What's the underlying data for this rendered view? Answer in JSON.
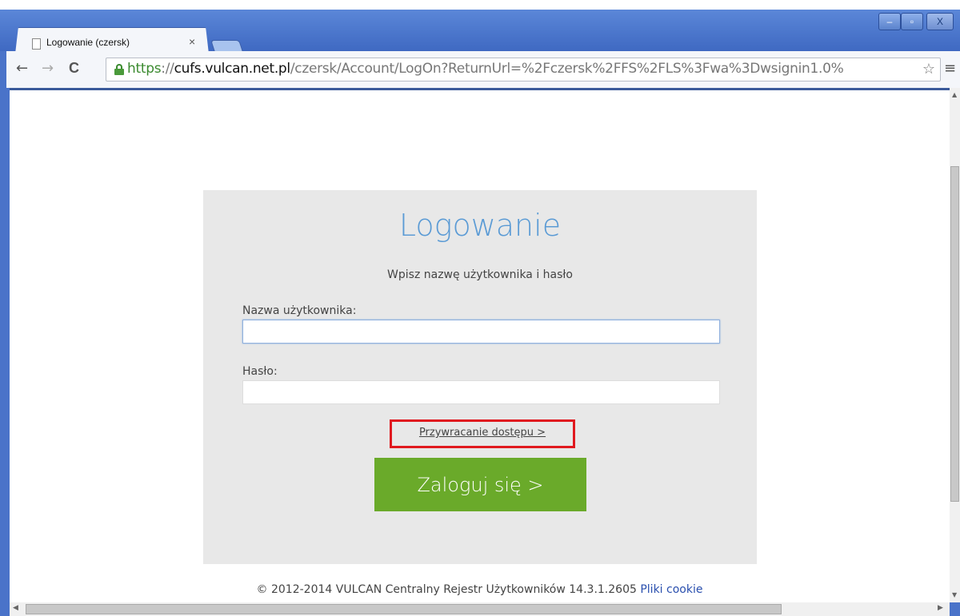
{
  "browser": {
    "tab_title": "Logowanie (czersk)",
    "tab_close": "×",
    "url_scheme": "https",
    "url_sep": "://",
    "url_host": "cufs.vulcan.net.pl",
    "url_path": "/czersk/Account/LogOn?ReturnUrl=%2Fczersk%2FFS%2FLS%3Fwa%3Dwsignin1.0%",
    "back_icon": "←",
    "forward_icon": "→",
    "reload_icon": "C",
    "star_icon": "☆",
    "menu_icon": "≡",
    "minimize": "–",
    "maximize": "▫",
    "close": "X"
  },
  "login": {
    "title": "Logowanie",
    "subtitle": "Wpisz nazwę użytkownika i hasło",
    "username_label": "Nazwa użytkownika:",
    "username_value": "",
    "password_label": "Hasło:",
    "password_value": "",
    "recover_link": "Przywracanie dostępu >",
    "submit_label": "Zaloguj się >"
  },
  "footer": {
    "text": "© 2012-2014 VULCAN Centralny Rejestr Użytkowników 14.3.1.2605",
    "cookie_link": "Pliki cookie"
  },
  "colors": {
    "title_blue": "#5b9bd5",
    "button_green": "#6aaa2a",
    "highlight_red": "#e0191f",
    "link_blue": "#2a4fae"
  }
}
